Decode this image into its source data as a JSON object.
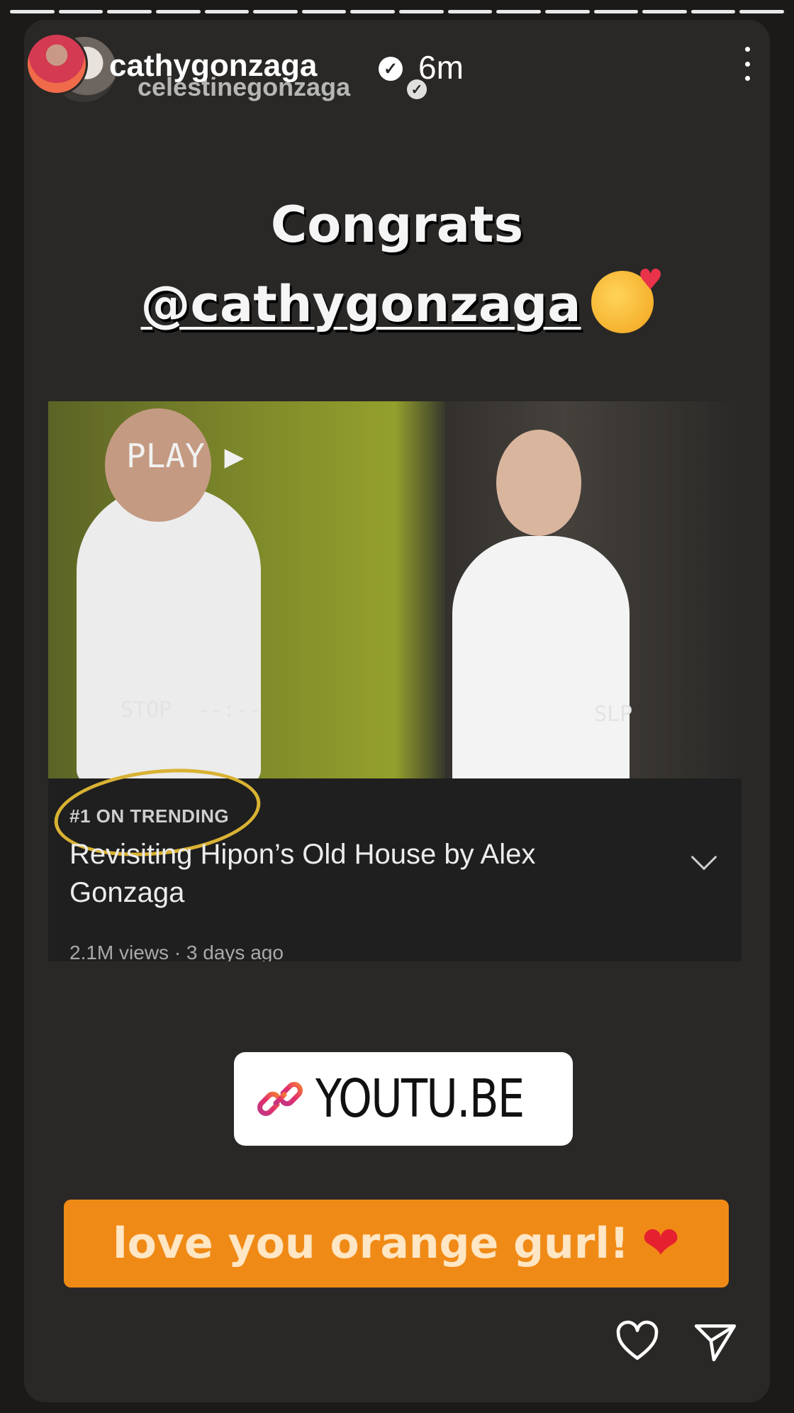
{
  "header": {
    "username": "cathygonzaga",
    "reposted_from": "celestinegonzaga",
    "time": "6m"
  },
  "story": {
    "line1": "Congrats",
    "mention": "@cathygonzaga"
  },
  "video": {
    "overlay_play": "PLAY ▶",
    "overlay_stop": "STOP",
    "overlay_stop_time": "--:--",
    "overlay_slp": "SLP",
    "trending_badge": "#1 ON TRENDING",
    "title": "Revisiting Hipon’s Old House by Alex Gonzaga",
    "meta": "2.1M views · 3 days ago"
  },
  "link_sticker": {
    "label": "YOUTU.BE"
  },
  "caption": {
    "text": "love you orange gurl!"
  },
  "icons": [
    "more-icon",
    "link-icon",
    "heart-icon",
    "send-icon"
  ],
  "colors": {
    "caption_bg": "#f08a16",
    "trend_ring": "#d9b233"
  }
}
